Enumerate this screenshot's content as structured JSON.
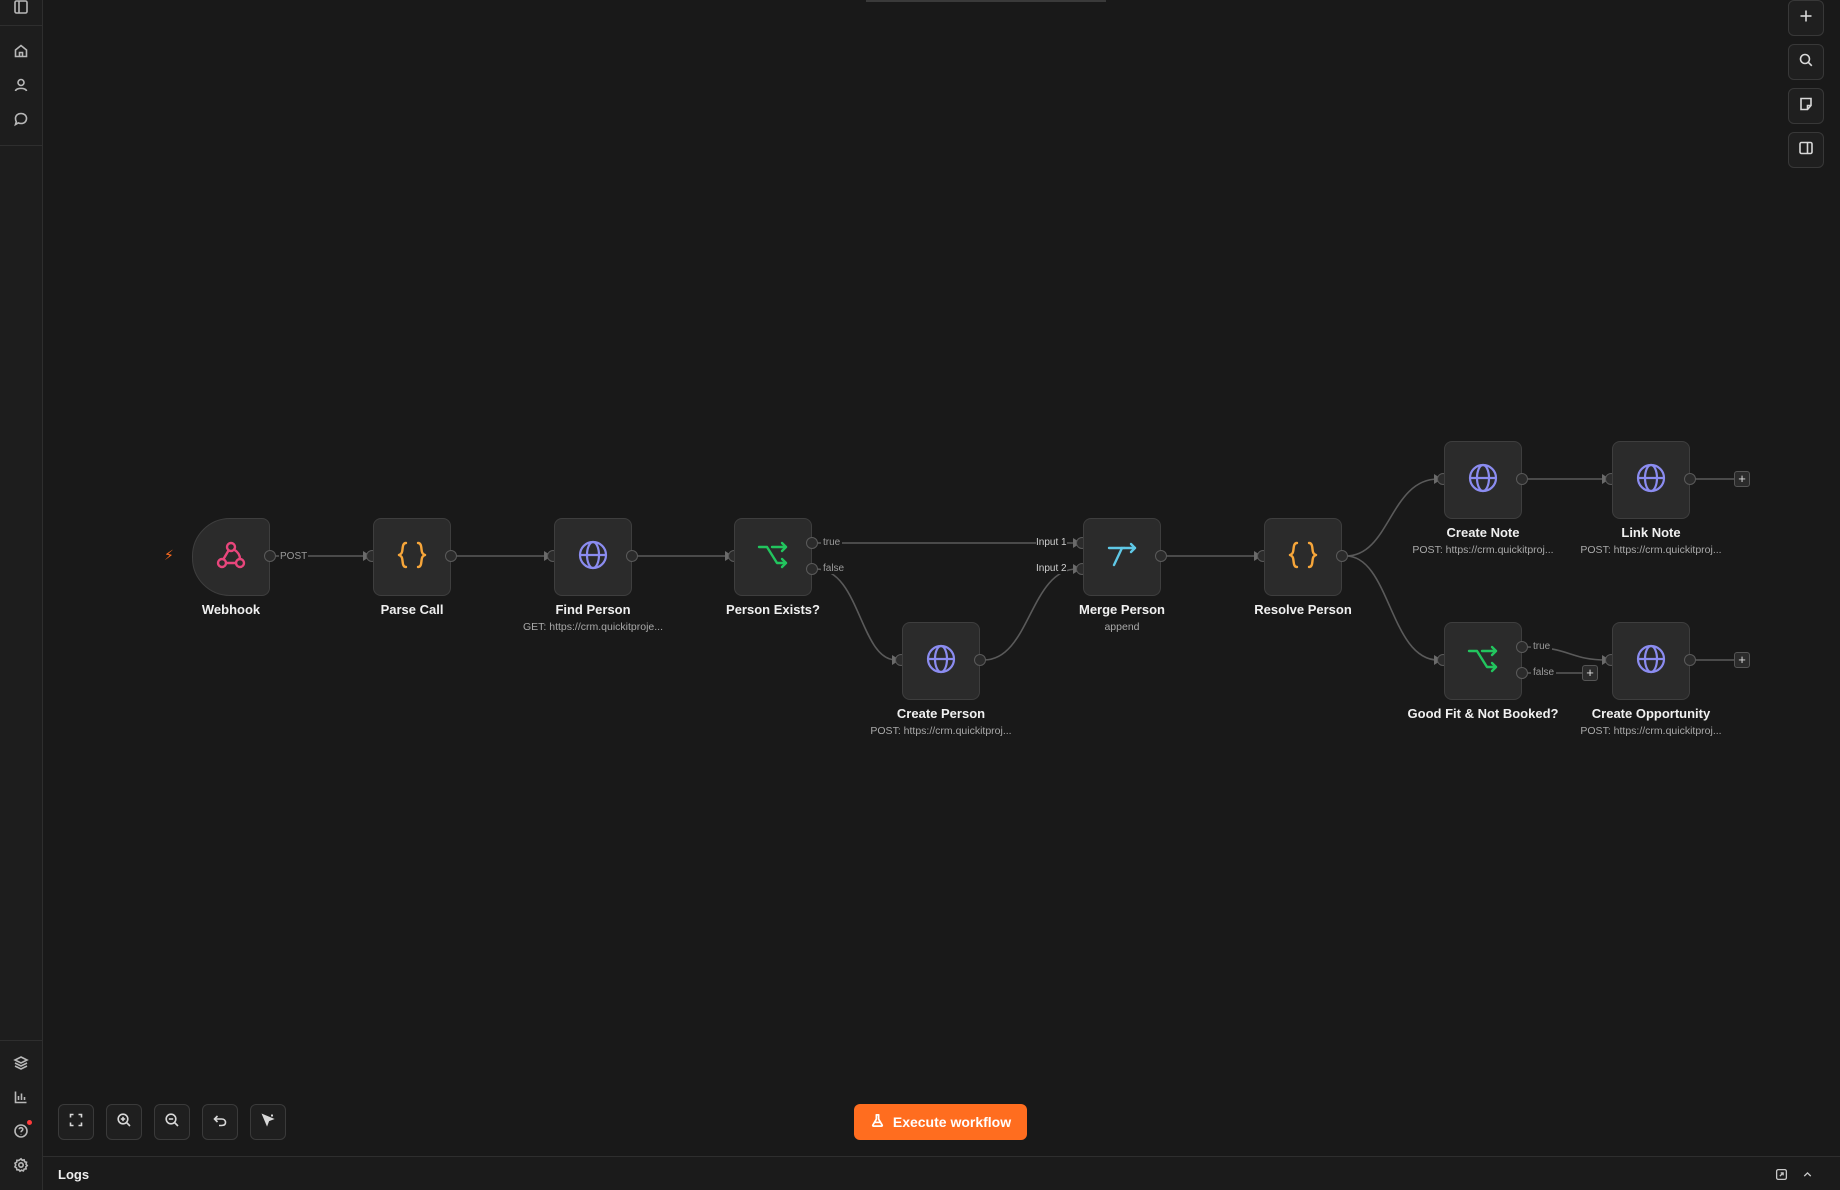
{
  "sidebar": {
    "top_icons": [
      "sidebar-toggle-icon",
      "home-icon",
      "user-icon",
      "chat-icon"
    ],
    "bottom_icons": [
      "templates-icon",
      "insights-icon",
      "help-icon",
      "settings-icon"
    ]
  },
  "toolbar_right": [
    "plus-icon",
    "search-icon",
    "sticky-note-icon",
    "panel-icon"
  ],
  "nodes": {
    "webhook": {
      "label": "Webhook",
      "icon": "webhook-icon",
      "color": "#e8467c"
    },
    "parse_call": {
      "label": "Parse Call",
      "icon": "code-braces-icon",
      "color": "#f7a63a"
    },
    "find_person": {
      "label": "Find Person",
      "sub": "GET: https://crm.quickitproje...",
      "icon": "globe-icon",
      "color": "#8b8cf0"
    },
    "person_exists": {
      "label": "Person Exists?",
      "icon": "if-branch-icon",
      "color": "#22c55e"
    },
    "create_person": {
      "label": "Create Person",
      "sub": "POST: https://crm.quickitproj...",
      "icon": "globe-icon",
      "color": "#8b8cf0"
    },
    "merge_person": {
      "label": "Merge Person",
      "sub": "append",
      "icon": "merge-icon",
      "color": "#5fc8e6"
    },
    "resolve_person": {
      "label": "Resolve Person",
      "icon": "code-braces-icon",
      "color": "#f7a63a"
    },
    "create_note": {
      "label": "Create Note",
      "sub": "POST: https://crm.quickitproj...",
      "icon": "globe-icon",
      "color": "#8b8cf0"
    },
    "link_note": {
      "label": "Link Note",
      "sub": "POST: https://crm.quickitproj...",
      "icon": "globe-icon",
      "color": "#8b8cf0"
    },
    "good_fit": {
      "label": "Good Fit & Not Booked?",
      "icon": "if-branch-icon",
      "color": "#22c55e"
    },
    "create_opportunity": {
      "label": "Create Opportunity",
      "sub": "POST: https://crm.quickitproj...",
      "icon": "globe-icon",
      "color": "#8b8cf0"
    }
  },
  "edge_labels": {
    "webhook_post": "POST",
    "exists_true": "true",
    "exists_false": "false",
    "merge_input1": "Input 1",
    "merge_input2": "Input 2",
    "goodfit_true": "true",
    "goodfit_false": "false"
  },
  "execute_button": {
    "label": "Execute workflow",
    "icon": "flask-icon"
  },
  "controls": [
    "fit-view-icon",
    "zoom-in-icon",
    "zoom-out-icon",
    "undo-icon",
    "tidy-up-icon"
  ],
  "logs": {
    "title": "Logs"
  },
  "colors": {
    "accent": "#ff6d1f",
    "background": "#191919"
  }
}
